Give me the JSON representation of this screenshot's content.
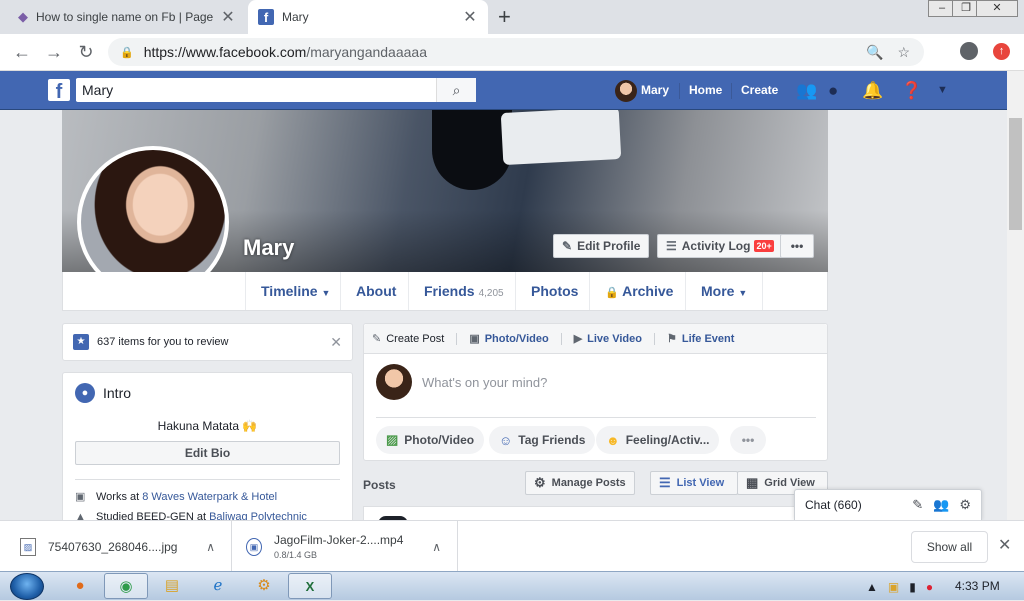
{
  "browser": {
    "tabs": [
      {
        "title": "How to single name on Fb | Page",
        "favicon": "fb-page-icon"
      },
      {
        "title": "Mary",
        "favicon": "facebook-icon"
      }
    ],
    "url_domain": "https://www.facebook.com",
    "url_path": "/maryangandaaaaa"
  },
  "fb_header": {
    "search_value": "Mary",
    "user_name": "Mary",
    "home": "Home",
    "create": "Create"
  },
  "profile": {
    "name": "Mary",
    "edit_profile": "Edit Profile",
    "activity_log": "Activity Log",
    "activity_badge": "20+",
    "more_dots": "•••",
    "nav": {
      "timeline": "Timeline",
      "about": "About",
      "friends": "Friends",
      "friends_count": "4,205",
      "photos": "Photos",
      "archive": "Archive",
      "more": "More"
    }
  },
  "review": {
    "text": "637 items for you to review"
  },
  "intro": {
    "title": "Intro",
    "bio": "Hakuna Matata 🙌",
    "edit_bio": "Edit Bio",
    "work_prefix": "Works at",
    "work_place": "8 Waves Waterpark & Hotel",
    "study_prefix": "Studied BEED-GEN at",
    "study_place": "Baliwag Polytechnic"
  },
  "composer": {
    "tabs": {
      "create_post": "Create Post",
      "photo_video": "Photo/Video",
      "live_video": "Live Video",
      "life_event": "Life Event"
    },
    "placeholder": "What's on your mind?",
    "actions": {
      "photo_video": "Photo/Video",
      "tag_friends": "Tag Friends",
      "feeling": "Feeling/Activ...",
      "more": "•••"
    }
  },
  "posts": {
    "title": "Posts",
    "manage": "Manage Posts",
    "list_view": "List View",
    "grid_view": "Grid View"
  },
  "chat": {
    "label": "Chat (660)"
  },
  "downloads": [
    {
      "name": "75407630_268046....jpg",
      "sub": ""
    },
    {
      "name": "JagoFilm-Joker-2....mp4",
      "sub": "0.8/1.4 GB"
    }
  ],
  "show_all": "Show all",
  "taskbar": {
    "clock": "4:33 PM"
  },
  "colors": {
    "fb_blue": "#4267b2",
    "link": "#365899",
    "badge_red": "#fa3e3e"
  }
}
